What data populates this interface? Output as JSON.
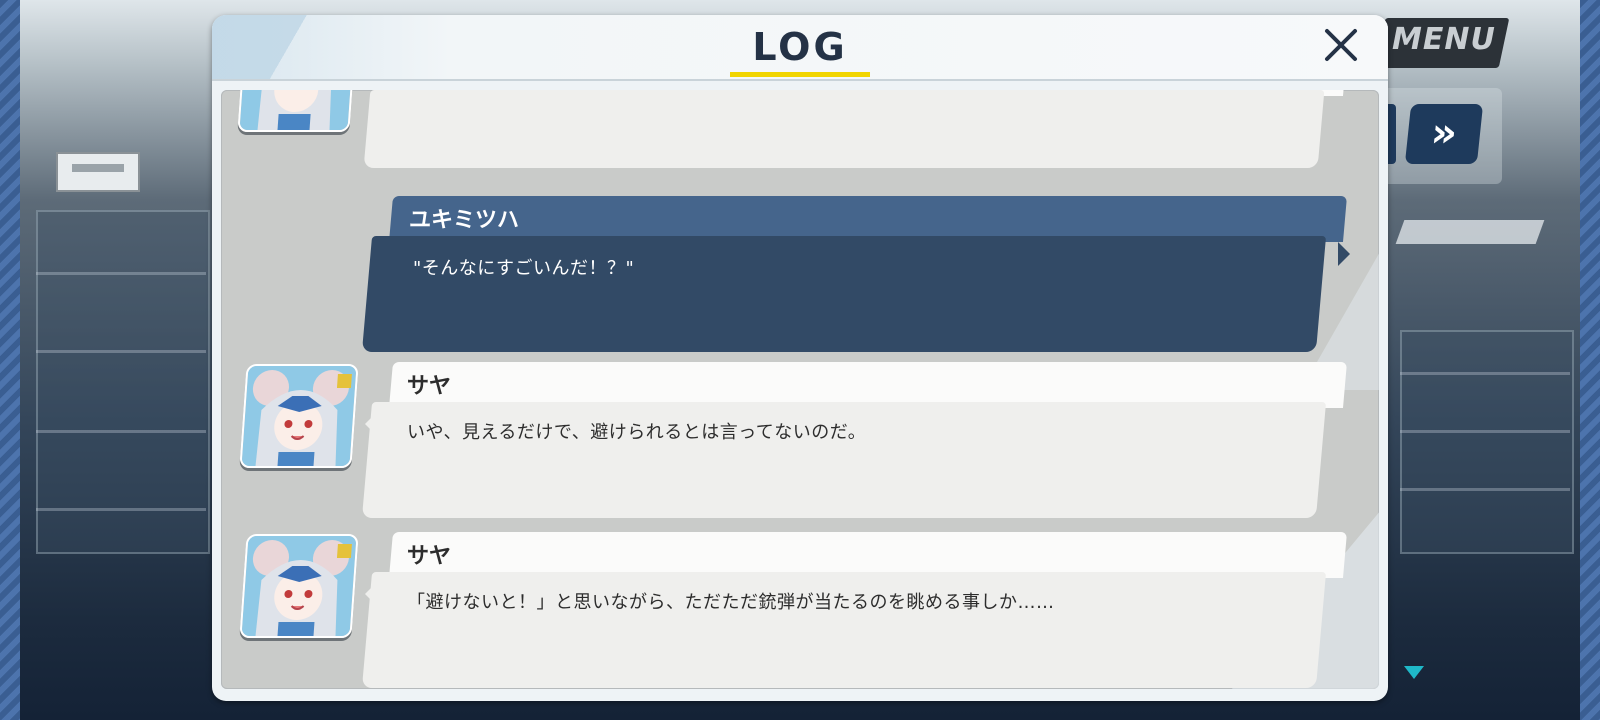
{
  "hud": {
    "menu_label": "MENU",
    "fast_forward_icon": "fast-forward-icon",
    "scroll_down_icon": "triangle-down-icon"
  },
  "log": {
    "title": "LOG",
    "close_icon": "close-icon",
    "entries": [
      {
        "speaker": "",
        "text": "",
        "style": "light",
        "has_avatar": true
      },
      {
        "speaker": "ユキミツハ",
        "text": "\"そんなにすごいんだ！？\"",
        "style": "dark",
        "has_avatar": false
      },
      {
        "speaker": "サヤ",
        "text": "いや、見えるだけで、避けられるとは言ってないのだ。",
        "style": "light",
        "has_avatar": true
      },
      {
        "speaker": "サヤ",
        "text": "「避けないと！」と思いながら、ただただ銃弾が当たるのを眺める事しか……",
        "style": "light",
        "has_avatar": true
      }
    ]
  },
  "colors": {
    "accent_yellow": "#f1d500",
    "player_bubble": "#324a66",
    "player_name_bar": "#45658c",
    "npc_bubble": "#efefed",
    "title_text": "#243246"
  }
}
